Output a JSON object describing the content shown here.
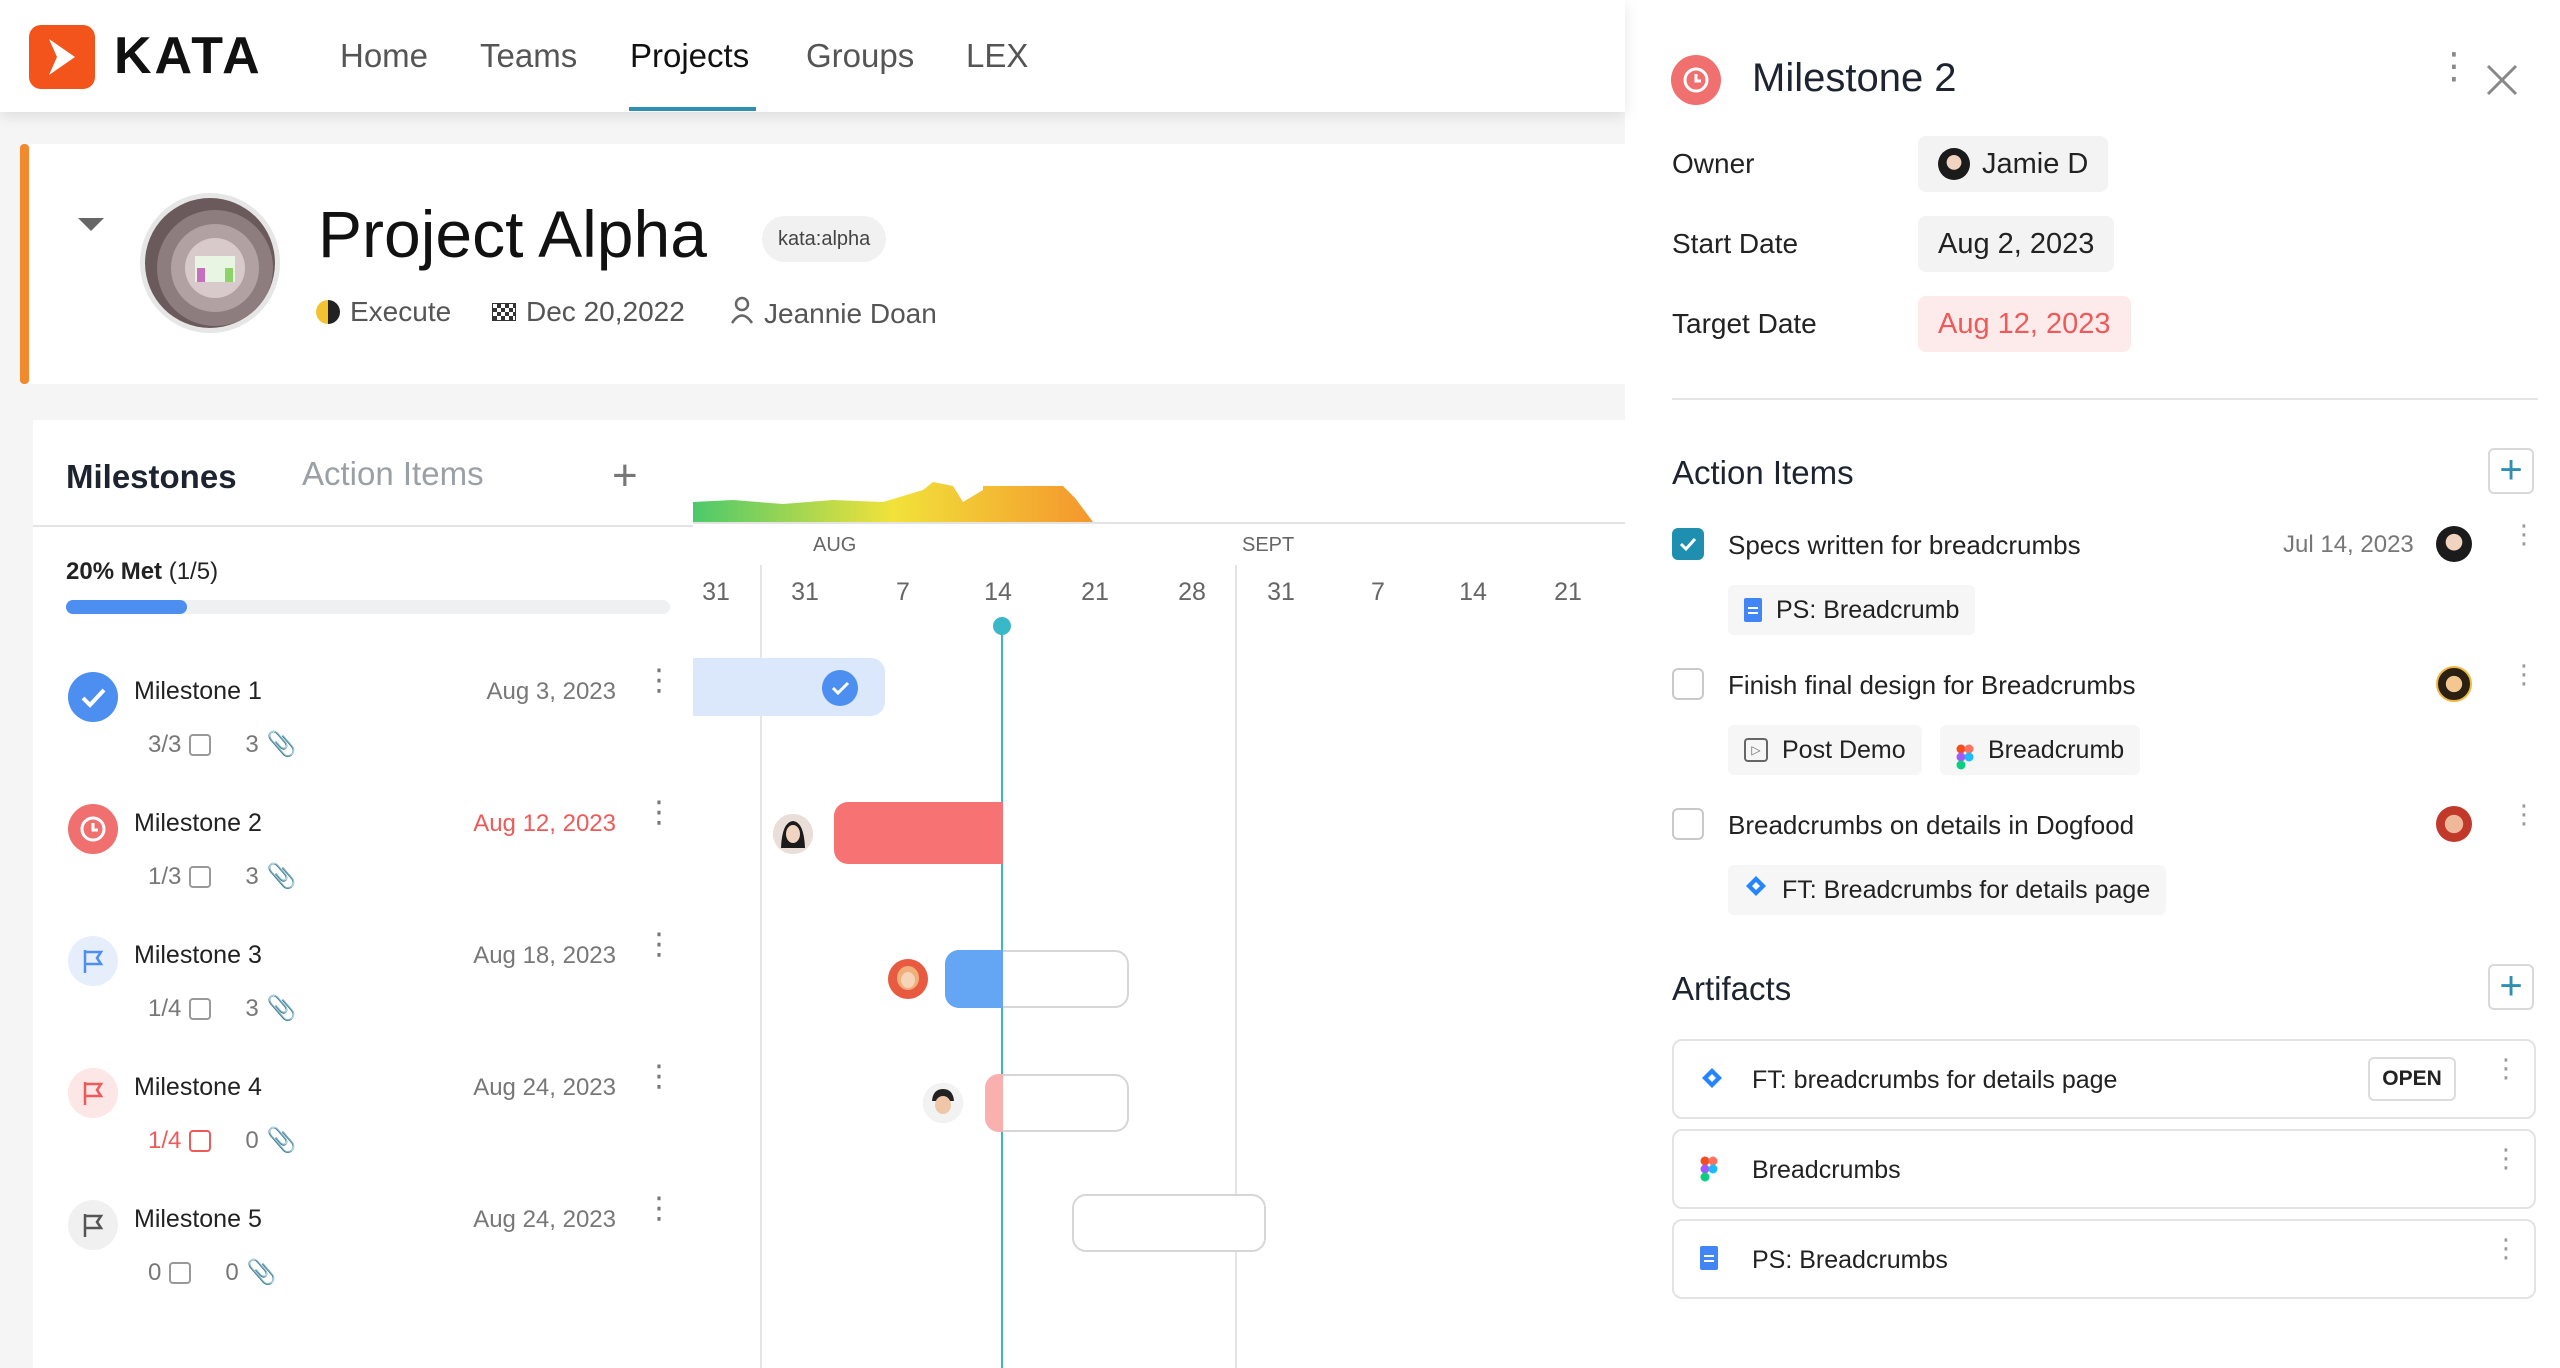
{
  "app": {
    "brand": "KATA",
    "accent": "#f2541b"
  },
  "nav": {
    "items": [
      "Home",
      "Teams",
      "Projects",
      "Groups",
      "LEX"
    ],
    "active": "Projects"
  },
  "project": {
    "title": "Project Alpha",
    "tag": "kata:alpha",
    "phase": "Execute",
    "due_date": "Dec 20,2022",
    "owner": "Jeannie Doan"
  },
  "left_panel": {
    "tabs": [
      "Milestones",
      "Action Items"
    ],
    "active_tab": "Milestones",
    "met_label": "20% Met",
    "met_count": "(1/5)",
    "met_fraction": 0.2,
    "milestones": [
      {
        "name": "Milestone 1",
        "date": "Aug 3, 2023",
        "date_status": "normal",
        "tasks": "3/3",
        "attachments": "3",
        "icon": "check-circle-icon"
      },
      {
        "name": "Milestone 2",
        "date": "Aug 12, 2023",
        "date_status": "overdue",
        "tasks": "1/3",
        "attachments": "3",
        "icon": "clock-icon"
      },
      {
        "name": "Milestone 3",
        "date": "Aug 18, 2023",
        "date_status": "normal",
        "tasks": "1/4",
        "attachments": "3",
        "icon": "flag-icon"
      },
      {
        "name": "Milestone 4",
        "date": "Aug 24, 2023",
        "date_status": "normal",
        "tasks": "1/4",
        "attachments": "0",
        "icon": "flag-icon"
      },
      {
        "name": "Milestone 5",
        "date": "Aug 24, 2023",
        "date_status": "normal",
        "tasks": "0",
        "attachments": "0",
        "icon": "flag-icon"
      }
    ]
  },
  "gantt": {
    "months": [
      "AUG",
      "SEPT"
    ],
    "days": [
      "31",
      "31",
      "7",
      "14",
      "21",
      "28",
      "31",
      "7",
      "14",
      "21"
    ]
  },
  "detail": {
    "title": "Milestone 2",
    "fields": {
      "owner_label": "Owner",
      "owner": "Jamie D",
      "start_label": "Start Date",
      "start": "Aug 2, 2023",
      "target_label": "Target Date",
      "target": "Aug 12, 2023"
    },
    "action_items_title": "Action Items",
    "action_items": [
      {
        "text": "Specs written for breadcrumbs",
        "date": "Jul 14, 2023",
        "checked": true,
        "attachments": [
          "PS: Breadcrumb"
        ]
      },
      {
        "text": "Finish final design for Breadcrumbs",
        "date": "",
        "checked": false,
        "attachments": [
          "Post Demo",
          "Breadcrumb"
        ]
      },
      {
        "text": "Breadcrumbs on details in Dogfood",
        "date": "",
        "checked": false,
        "attachments": [
          "FT: Breadcrumbs for details page"
        ]
      }
    ],
    "artifacts_title": "Artifacts",
    "artifacts": [
      {
        "name": "FT: breadcrumbs for details page",
        "type": "jira",
        "action": "OPEN"
      },
      {
        "name": "Breadcrumbs",
        "type": "figma"
      },
      {
        "name": "PS: Breadcrumbs",
        "type": "doc"
      }
    ]
  },
  "colors": {
    "overdue": "#ee5a5a",
    "progress": "#4c8ff0",
    "today_line": "#39b8c8",
    "teal": "#1f8fb0"
  }
}
